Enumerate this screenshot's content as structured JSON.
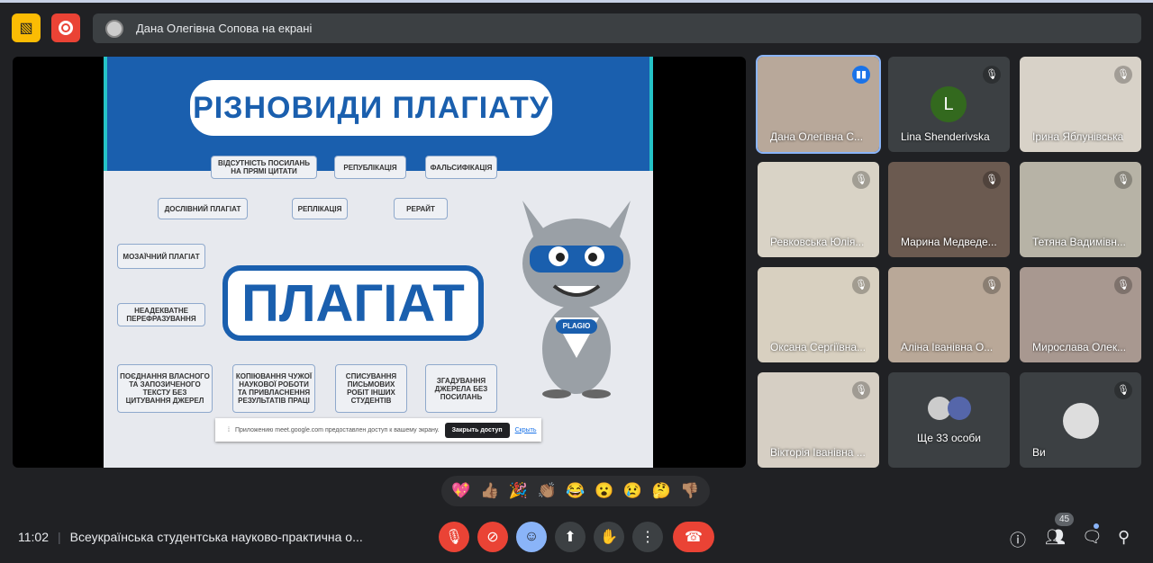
{
  "presenter_banner": {
    "text": "Дана Олегівна Сопова на екрані"
  },
  "slide": {
    "title": "РІЗНОВИДИ ПЛАГІАТУ",
    "center": "ПЛАГІАТ",
    "nodes": [
      "ВІДСУТНІСТЬ ПОСИЛАНЬ НА ПРЯМІ ЦИТАТИ",
      "РЕПУБЛІКАЦІЯ",
      "ФАЛЬСИФІКАЦІЯ",
      "ДОСЛІВНИЙ ПЛАГІАТ",
      "РЕПЛІКАЦІЯ",
      "РЕРАЙТ",
      "МОЗАЇЧНИЙ ПЛАГІАТ",
      "НЕАДЕКВАТНЕ ПЕРЕФРАЗУВАННЯ",
      "ПОЄДНАННЯ ВЛАСНОГО ТА ЗАПОЗИЧЕНОГО ТЕКСТУ БЕЗ ЦИТУВАННЯ ДЖЕРЕЛ",
      "КОПІЮВАННЯ ЧУЖОЇ НАУКОВОЇ РОБОТИ ТА ПРИВЛАСНЕННЯ РЕЗУЛЬТАТІВ ПРАЦІ",
      "СПИСУВАННЯ ПИСЬМОВИХ РОБІТ ІНШИХ СТУДЕНТІВ",
      "ЗГАДУВАННЯ ДЖЕРЕЛА БЕЗ ПОСИЛАНЬ"
    ],
    "mascot_badge": "PLAGIO"
  },
  "share_bar": {
    "message": "Приложению meet.google.com предоставлен доступ к вашему экрану.",
    "stop_label": "Закрыть доступ",
    "hide_label": "Скрыть"
  },
  "participants": [
    {
      "name": "Дана Олегівна С...",
      "speaking": true
    },
    {
      "name": "Lina Shenderivska",
      "initial": "L",
      "muted": true
    },
    {
      "name": "Ірина Яблунівська",
      "muted": true
    },
    {
      "name": "Ревковська Юлія...",
      "muted": true
    },
    {
      "name": "Марина Медведе...",
      "muted": true
    },
    {
      "name": "Тетяна Вадимівн...",
      "muted": true
    },
    {
      "name": "Оксана Сергіївна...",
      "muted": true
    },
    {
      "name": "Аліна Іванівна О...",
      "muted": true
    },
    {
      "name": "Мирослава Олек...",
      "muted": true
    },
    {
      "name": "Вікторія Іванівна ...",
      "muted": true
    },
    {
      "name": "Ще 33 особи"
    },
    {
      "name": "Ви",
      "muted": true
    }
  ],
  "reactions": [
    "💖",
    "👍🏽",
    "🎉",
    "👏🏽",
    "😂",
    "😮",
    "😢",
    "🤔",
    "👎🏽"
  ],
  "bottom": {
    "time": "11:02",
    "meeting_title": "Всеукраїнська студентська науково-практична о...",
    "participant_count": "45"
  },
  "colors": {
    "red": "#ea4335",
    "blue": "#8ab4f8",
    "gray": "#3c4043",
    "accent": "#1a5fae"
  }
}
